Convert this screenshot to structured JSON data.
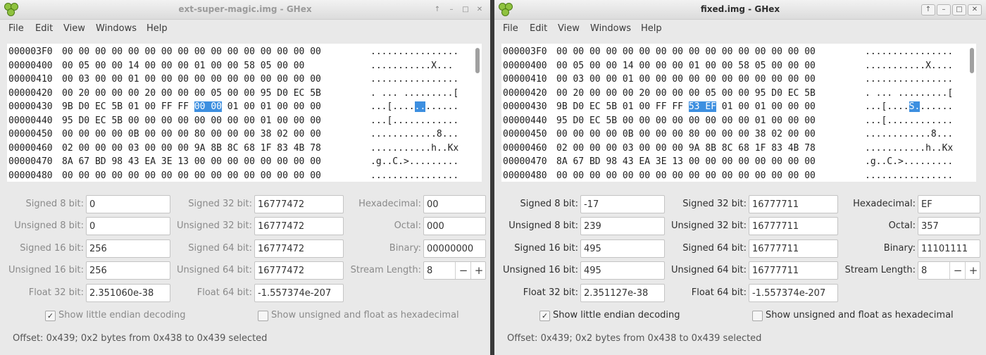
{
  "menu": [
    "File",
    "Edit",
    "View",
    "Windows",
    "Help"
  ],
  "window_buttons": [
    "↑",
    "–",
    "□",
    "✕"
  ],
  "labels": {
    "signed8": "Signed 8 bit:",
    "unsigned8": "Unsigned 8 bit:",
    "signed16": "Signed 16 bit:",
    "unsigned16": "Unsigned 16 bit:",
    "float32": "Float 32 bit:",
    "signed32": "Signed 32 bit:",
    "unsigned32": "Unsigned 32 bit:",
    "signed64": "Signed 64 bit:",
    "unsigned64": "Unsigned 64 bit:",
    "float64": "Float 64 bit:",
    "hexadecimal": "Hexadecimal:",
    "octal": "Octal:",
    "binary": "Binary:",
    "stream_length": "Stream Length:",
    "little_endian": "Show little endian decoding",
    "unsigned_hex": "Show unsigned and float as hexadecimal"
  },
  "windows": [
    {
      "title": "ext-super-magic.img - GHex",
      "active": false,
      "rows": [
        {
          "offset": "000003F0",
          "hex": "00 00 00 00 00 00 00 00 00 00 00 00 00 00 00 00",
          "ascii": "................"
        },
        {
          "offset": "00000400",
          "hex": "00 05 00 00 14 00 00 00 01 00 00 58 05 00 00",
          "ascii": "...........X..."
        },
        {
          "offset": "00000410",
          "hex": "00 03 00 00 01 00 00 00 00 00 00 00 00 00 00 00",
          "ascii": "................"
        },
        {
          "offset": "00000420",
          "hex": "00 20 00 00 00 20 00 00 00 05 00 00 95 D0 EC 5B",
          "ascii": ". ... .........["
        },
        {
          "offset": "00000430",
          "hex": "9B D0 EC 5B 01 00 FF FF 00 00 01 00 01 00 00 00",
          "ascii": "...[............",
          "sel_hex": [
            8,
            9
          ],
          "sel_ascii": [
            8,
            9
          ]
        },
        {
          "offset": "00000440",
          "hex": "95 D0 EC 5B 00 00 00 00 00 00 00 00 01 00 00 00",
          "ascii": "...[............"
        },
        {
          "offset": "00000450",
          "hex": "00 00 00 00 0B 00 00 00 80 00 00 00 38 02 00 00",
          "ascii": "............8..."
        },
        {
          "offset": "00000460",
          "hex": "02 00 00 00 03 00 00 00 9A 8B 8C 68 1F 83 4B 78",
          "ascii": "...........h..Kx"
        },
        {
          "offset": "00000470",
          "hex": "8A 67 BD 98 43 EA 3E 13 00 00 00 00 00 00 00 00",
          "ascii": ".g..C.>........."
        },
        {
          "offset": "00000480",
          "hex": "00 00 00 00 00 00 00 00 00 00 00 00 00 00 00 00",
          "ascii": "................"
        }
      ],
      "values": {
        "signed8": "0",
        "unsigned8": "0",
        "signed16": "256",
        "unsigned16": "256",
        "float32": "2.351060e-38",
        "signed32": "16777472",
        "unsigned32": "16777472",
        "signed64": "16777472",
        "unsigned64": "16777472",
        "float64": "-1.557374e-207",
        "hexadecimal": "00",
        "octal": "000",
        "binary": "00000000",
        "stream_length": "8"
      },
      "little_endian": true,
      "unsigned_hex": false,
      "status": "Offset: 0x439; 0x2 bytes from 0x438 to 0x439 selected"
    },
    {
      "title": "fixed.img - GHex",
      "active": true,
      "rows": [
        {
          "offset": "000003F0",
          "hex": "00 00 00 00 00 00 00 00 00 00 00 00 00 00 00 00",
          "ascii": "................"
        },
        {
          "offset": "00000400",
          "hex": "00 05 00 00 14 00 00 00 01 00 00 58 05 00 00 00",
          "ascii": "...........X...."
        },
        {
          "offset": "00000410",
          "hex": "00 03 00 00 01 00 00 00 00 00 00 00 00 00 00 00",
          "ascii": "................"
        },
        {
          "offset": "00000420",
          "hex": "00 20 00 00 00 20 00 00 00 05 00 00 95 D0 EC 5B",
          "ascii": ". ... .........["
        },
        {
          "offset": "00000430",
          "hex": "9B D0 EC 5B 01 00 FF FF 53 EF 01 00 01 00 00 00",
          "ascii": "...[....S.......",
          "sel_hex": [
            8,
            9
          ],
          "sel_ascii": [
            8,
            9
          ]
        },
        {
          "offset": "00000440",
          "hex": "95 D0 EC 5B 00 00 00 00 00 00 00 00 01 00 00 00",
          "ascii": "...[............"
        },
        {
          "offset": "00000450",
          "hex": "00 00 00 00 0B 00 00 00 80 00 00 00 38 02 00 00",
          "ascii": "............8..."
        },
        {
          "offset": "00000460",
          "hex": "02 00 00 00 03 00 00 00 9A 8B 8C 68 1F 83 4B 78",
          "ascii": "...........h..Kx"
        },
        {
          "offset": "00000470",
          "hex": "8A 67 BD 98 43 EA 3E 13 00 00 00 00 00 00 00 00",
          "ascii": ".g..C.>........."
        },
        {
          "offset": "00000480",
          "hex": "00 00 00 00 00 00 00 00 00 00 00 00 00 00 00 00",
          "ascii": "................"
        }
      ],
      "values": {
        "signed8": "-17",
        "unsigned8": "239",
        "signed16": "495",
        "unsigned16": "495",
        "float32": "2.351127e-38",
        "signed32": "16777711",
        "unsigned32": "16777711",
        "signed64": "16777711",
        "unsigned64": "16777711",
        "float64": "-1.557374e-207",
        "hexadecimal": "EF",
        "octal": "357",
        "binary": "11101111",
        "stream_length": "8"
      },
      "little_endian": true,
      "unsigned_hex": false,
      "status": "Offset: 0x439; 0x2 bytes from 0x438 to 0x439 selected"
    }
  ]
}
